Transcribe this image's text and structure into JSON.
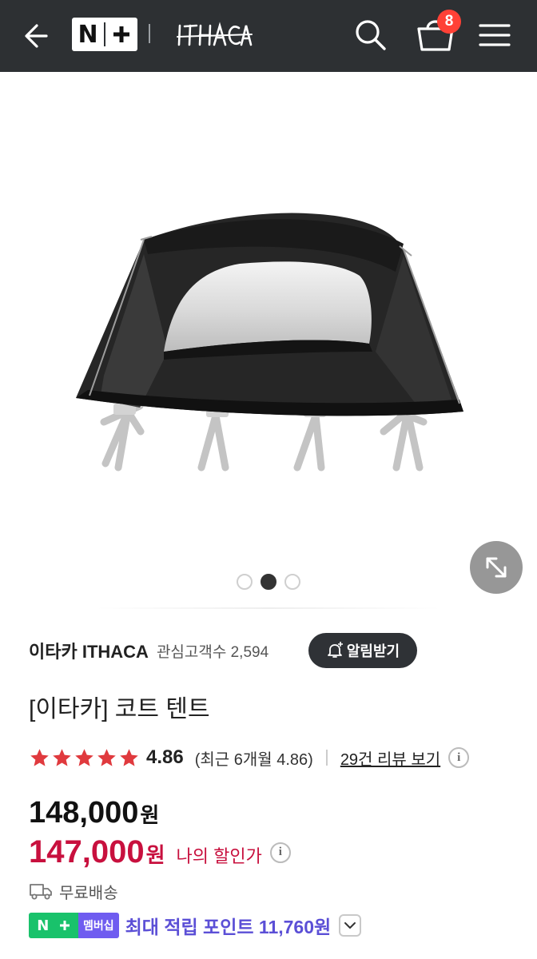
{
  "header": {
    "back_icon": "arrow-left-icon",
    "partner_logo": "N+",
    "brand_logo": "ITHACA",
    "search_icon": "search-icon",
    "cart_icon": "shopping-bag-icon",
    "cart_count": "8",
    "menu_icon": "hamburger-menu-icon"
  },
  "gallery": {
    "slide_count": 3,
    "active_index": 1,
    "expand_icon": "expand-diagonal-icon"
  },
  "store": {
    "name": "이타카 ITHACA",
    "fans": "관심고객수 2,594",
    "alarm_label": "알림받기"
  },
  "product": {
    "title": "[이타카] 코트 텐트",
    "rating_stars": 5,
    "score": "4.86",
    "recent": "(최근 6개월 4.86)",
    "reviews_link": "29건 리뷰 보기"
  },
  "price": {
    "original": "148,000",
    "original_unit": "원",
    "sale": "147,000",
    "sale_unit": "원",
    "sale_label": "나의 할인가"
  },
  "shipping": {
    "label": "무료배송"
  },
  "membership": {
    "badge_label": "멤버십",
    "points_text": "최대 적립 포인트 11,760원"
  },
  "colors": {
    "header_bg": "#2d3033",
    "sale_red": "#c8103e",
    "badge_red": "#ff4136",
    "star_red": "#e03a3e",
    "membership_green": "#19c26b",
    "membership_purple": "#6f5cf0"
  }
}
